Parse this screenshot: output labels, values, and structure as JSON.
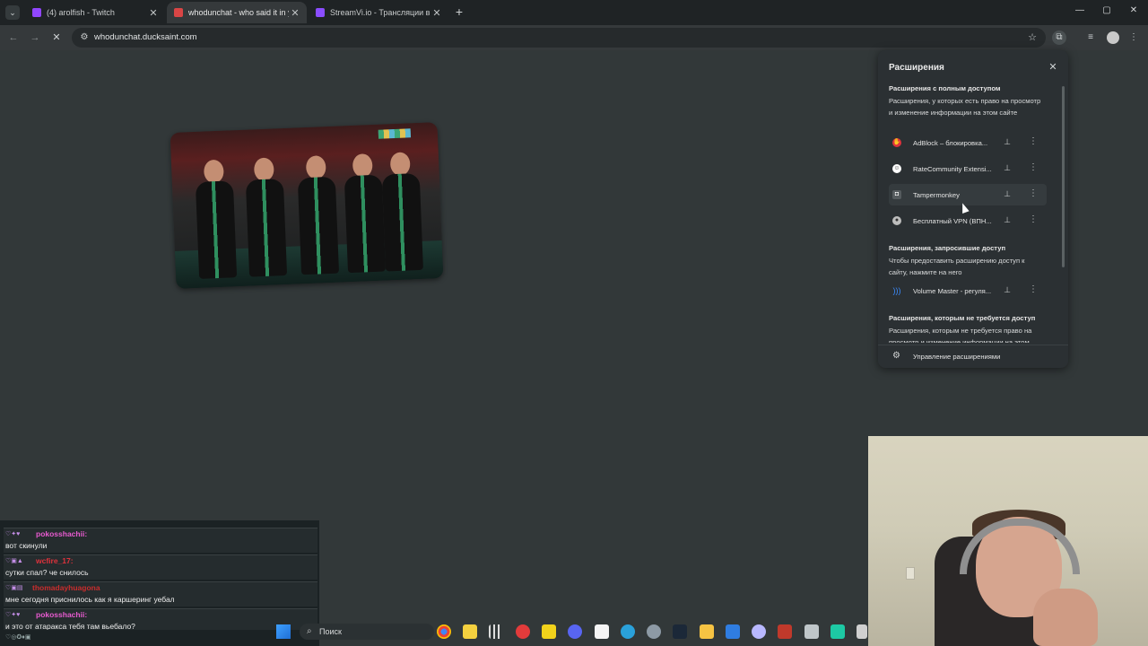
{
  "browser": {
    "tabs": [
      {
        "label": "(4) arolfish - Twitch",
        "favicon": "twitch-icon",
        "active": false
      },
      {
        "label": "whodunchat - who said it in your chat",
        "favicon": "whodunchat-icon",
        "active": true
      },
      {
        "label": "StreamVi.io - Трансляции в неск",
        "favicon": "streamvi-icon",
        "active": false
      }
    ],
    "url": "whodunchat.ducksaint.com"
  },
  "extensions_panel": {
    "title": "Расширения",
    "sections": [
      {
        "title": "Расширения с полным доступом",
        "description": "Расширения, у которых есть право на просмотр и изменение информации на этом сайте",
        "items": [
          {
            "name": "AdBlock – блокировка...",
            "icon": "adblock-icon",
            "color": "#e0323c"
          },
          {
            "name": "RateCommunity Extensi...",
            "icon": "ratecommunity-icon",
            "color": "#ffffff"
          },
          {
            "name": "Tampermonkey",
            "icon": "tampermonkey-icon",
            "color": "#555b5e"
          },
          {
            "name": "Бесплатный VPN (ВПН...",
            "icon": "vpn-globe-icon",
            "color": "#bdbdbd"
          }
        ]
      },
      {
        "title": "Расширения, запросившие доступ",
        "description": "Чтобы предоставить расширению доступ к сайту, нажмите на него",
        "items": [
          {
            "name": "Volume Master - регуля...",
            "icon": "volume-master-icon",
            "color": "#3c8cff"
          }
        ]
      },
      {
        "title": "Расширения, которым не требуется доступ",
        "description": "Расширения, которым не требуется право на просмотр и изменение информации на этом",
        "items": []
      }
    ],
    "footer_label": "Управление расширениями"
  },
  "chat": {
    "messages": [
      {
        "user": "pokosshachii:",
        "color": "#e85bd0",
        "text": "вот скинули"
      },
      {
        "user": "wcfire_17:",
        "color": "#e0323c",
        "text": "сутки спал? че снилось"
      },
      {
        "user": "thomadayhuagona",
        "color": "#c92d2d",
        "text": "мне сегодня приснилось как я каршеринг уебал"
      },
      {
        "user": "pokosshachii:",
        "color": "#e85bd0",
        "text": "и это от атаракса тебя там вьебало?"
      }
    ]
  },
  "taskbar": {
    "search_label": "Поиск"
  }
}
